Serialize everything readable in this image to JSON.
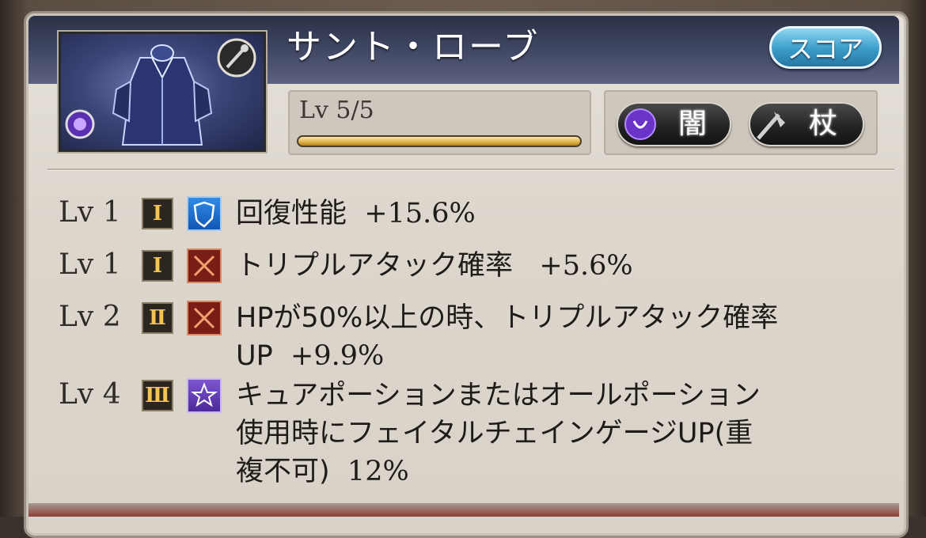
{
  "item": {
    "name": "サント・ローブ",
    "score_label": "スコア",
    "level_text": "Lv 5/5",
    "level_progress": 1.0,
    "element_label": "闇",
    "weapon_label": "杖",
    "element_icon": "dark-element-icon",
    "weapon_icon": "staff-icon",
    "colors": {
      "header": "#2b3146",
      "panel": "#dcd6cd",
      "score_button": "#3a9cc8",
      "level_bar": "#e3b652"
    }
  },
  "skills": [
    {
      "lv": "Lv 1",
      "rank": "Ⅰ",
      "icon": "shield-icon",
      "line1": "回復性能",
      "value": "+15.6%",
      "line2": "",
      "line3": ""
    },
    {
      "lv": "Lv 1",
      "rank": "Ⅰ",
      "icon": "crossed-swords-icon",
      "line1": "トリプルアタック確率",
      "value": "+5.6%",
      "line2": "",
      "line3": ""
    },
    {
      "lv": "Lv 2",
      "rank": "Ⅱ",
      "icon": "crossed-swords-icon",
      "line1": "HPが50%以上の時、トリプルアタック確率",
      "line2": "UP",
      "value": "+9.9%",
      "line3": ""
    },
    {
      "lv": "Lv 4",
      "rank": "Ⅲ",
      "icon": "star-icon",
      "line1": "キュアポーションまたはオールポーション",
      "line2": "使用時にフェイタルチェインゲージUP(重",
      "line3": "複不可)",
      "value": "12%"
    }
  ]
}
